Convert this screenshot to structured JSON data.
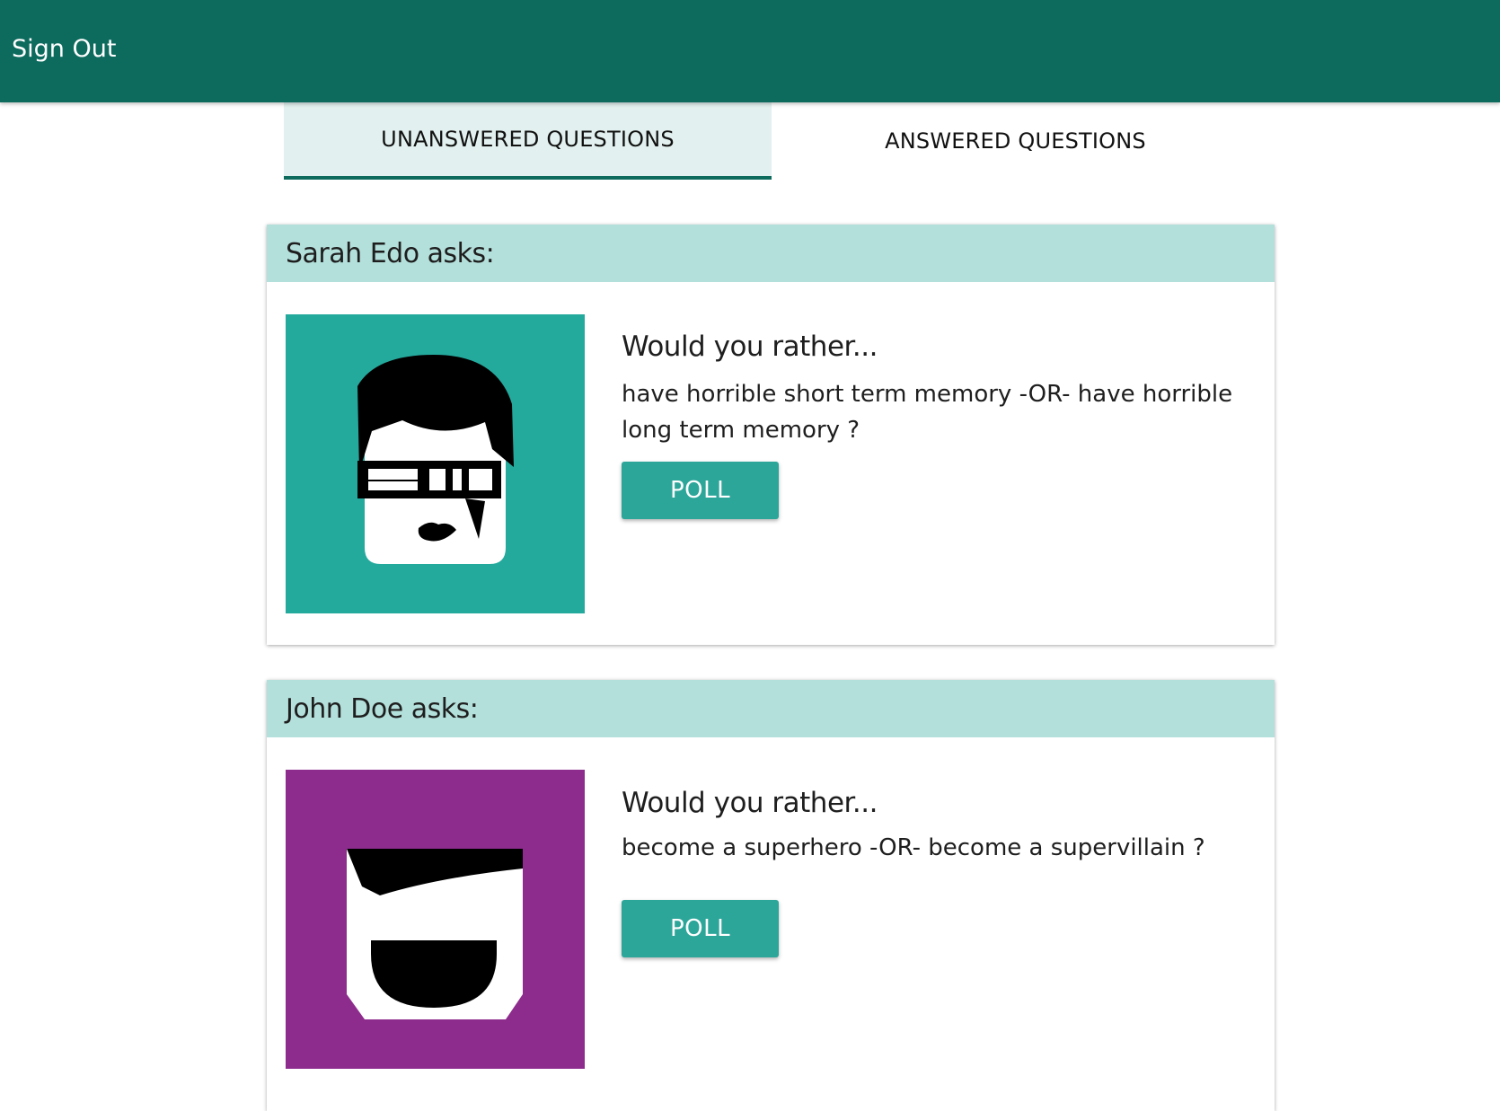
{
  "header": {
    "sign_out_label": "Sign Out",
    "bar_color": "#0d6b5e"
  },
  "tabs": [
    {
      "label": "UNANSWERED QUESTIONS",
      "active": true
    },
    {
      "label": "ANSWERED QUESTIONS",
      "active": false
    }
  ],
  "questions": [
    {
      "asker": "Sarah Edo asks:",
      "avatar_icon": "sarah-edo-avatar-icon",
      "avatar_color": "#24a99d",
      "prompt": "Would you rather...",
      "text": "have horrible short term memory -OR- have horrible long term memory ?",
      "button_label": "POLL"
    },
    {
      "asker": "John Doe asks:",
      "avatar_icon": "john-doe-avatar-icon",
      "avatar_color": "#8e2c8e",
      "prompt": "Would you rather...",
      "text": "become a superhero -OR- become a supervillain ?",
      "button_label": "POLL"
    }
  ]
}
